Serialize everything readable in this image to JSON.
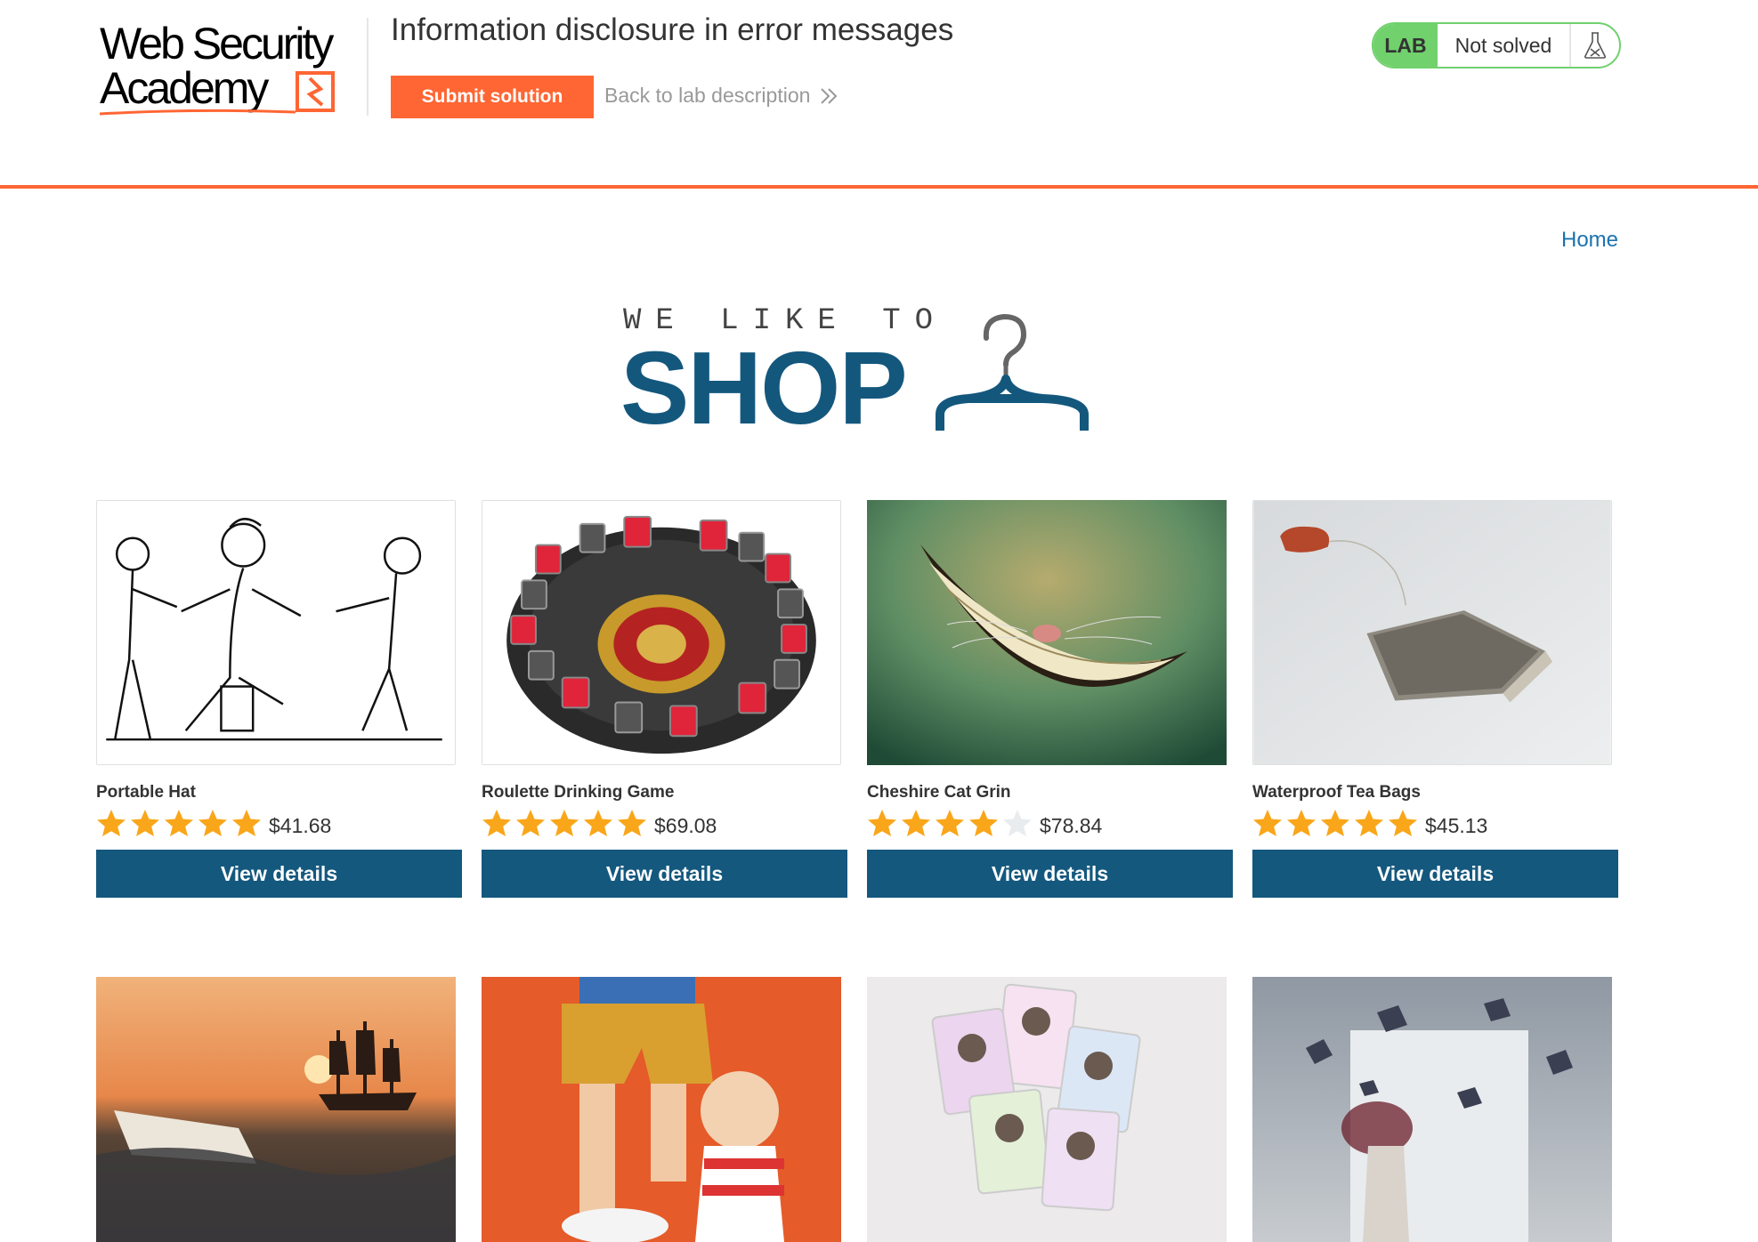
{
  "academy": {
    "logo_line1": "Web Security",
    "logo_line2": "Academy",
    "lab_title": "Information disclosure in error messages",
    "submit_label": "Submit solution",
    "back_label": "Back to lab description",
    "lab_badge": "LAB",
    "lab_state": "Not solved"
  },
  "colors": {
    "accent_orange": "#ff6633",
    "lab_green": "#70d16d",
    "shop_blue": "#14587e",
    "link_blue": "#1a73b0",
    "star": "#f9a61a"
  },
  "nav": {
    "home_label": "Home"
  },
  "banner": {
    "top_text": "WE LIKE TO",
    "main_text": "SHOP",
    "icon": "hanger-icon"
  },
  "products": [
    {
      "name": "Portable Hat",
      "rating": 5,
      "price": "$41.68",
      "button": "View details",
      "image": "portable-hat-sketch"
    },
    {
      "name": "Roulette Drinking Game",
      "rating": 5,
      "price": "$69.08",
      "button": "View details",
      "image": "roulette-drinking-game"
    },
    {
      "name": "Cheshire Cat Grin",
      "rating": 4,
      "price": "$78.84",
      "button": "View details",
      "image": "cheshire-cat-grin"
    },
    {
      "name": "Waterproof Tea Bags",
      "rating": 5,
      "price": "$45.13",
      "button": "View details",
      "image": "waterproof-tea-bag"
    },
    {
      "name": "",
      "image": "paper-boat-sunset"
    },
    {
      "name": "",
      "image": "toy-figure-orange"
    },
    {
      "name": "",
      "image": "politician-cards"
    },
    {
      "name": "",
      "image": "flying-books"
    }
  ]
}
